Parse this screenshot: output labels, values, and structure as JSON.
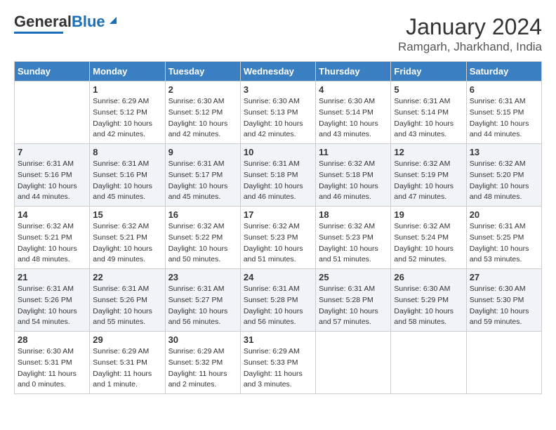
{
  "logo": {
    "text_general": "General",
    "text_blue": "Blue"
  },
  "title": "January 2024",
  "subtitle": "Ramgarh, Jharkhand, India",
  "header_days": [
    "Sunday",
    "Monday",
    "Tuesday",
    "Wednesday",
    "Thursday",
    "Friday",
    "Saturday"
  ],
  "weeks": [
    [
      {
        "num": "",
        "info": ""
      },
      {
        "num": "1",
        "info": "Sunrise: 6:29 AM\nSunset: 5:12 PM\nDaylight: 10 hours\nand 42 minutes."
      },
      {
        "num": "2",
        "info": "Sunrise: 6:30 AM\nSunset: 5:12 PM\nDaylight: 10 hours\nand 42 minutes."
      },
      {
        "num": "3",
        "info": "Sunrise: 6:30 AM\nSunset: 5:13 PM\nDaylight: 10 hours\nand 42 minutes."
      },
      {
        "num": "4",
        "info": "Sunrise: 6:30 AM\nSunset: 5:14 PM\nDaylight: 10 hours\nand 43 minutes."
      },
      {
        "num": "5",
        "info": "Sunrise: 6:31 AM\nSunset: 5:14 PM\nDaylight: 10 hours\nand 43 minutes."
      },
      {
        "num": "6",
        "info": "Sunrise: 6:31 AM\nSunset: 5:15 PM\nDaylight: 10 hours\nand 44 minutes."
      }
    ],
    [
      {
        "num": "7",
        "info": "Sunrise: 6:31 AM\nSunset: 5:16 PM\nDaylight: 10 hours\nand 44 minutes."
      },
      {
        "num": "8",
        "info": "Sunrise: 6:31 AM\nSunset: 5:16 PM\nDaylight: 10 hours\nand 45 minutes."
      },
      {
        "num": "9",
        "info": "Sunrise: 6:31 AM\nSunset: 5:17 PM\nDaylight: 10 hours\nand 45 minutes."
      },
      {
        "num": "10",
        "info": "Sunrise: 6:31 AM\nSunset: 5:18 PM\nDaylight: 10 hours\nand 46 minutes."
      },
      {
        "num": "11",
        "info": "Sunrise: 6:32 AM\nSunset: 5:18 PM\nDaylight: 10 hours\nand 46 minutes."
      },
      {
        "num": "12",
        "info": "Sunrise: 6:32 AM\nSunset: 5:19 PM\nDaylight: 10 hours\nand 47 minutes."
      },
      {
        "num": "13",
        "info": "Sunrise: 6:32 AM\nSunset: 5:20 PM\nDaylight: 10 hours\nand 48 minutes."
      }
    ],
    [
      {
        "num": "14",
        "info": "Sunrise: 6:32 AM\nSunset: 5:21 PM\nDaylight: 10 hours\nand 48 minutes."
      },
      {
        "num": "15",
        "info": "Sunrise: 6:32 AM\nSunset: 5:21 PM\nDaylight: 10 hours\nand 49 minutes."
      },
      {
        "num": "16",
        "info": "Sunrise: 6:32 AM\nSunset: 5:22 PM\nDaylight: 10 hours\nand 50 minutes."
      },
      {
        "num": "17",
        "info": "Sunrise: 6:32 AM\nSunset: 5:23 PM\nDaylight: 10 hours\nand 51 minutes."
      },
      {
        "num": "18",
        "info": "Sunrise: 6:32 AM\nSunset: 5:23 PM\nDaylight: 10 hours\nand 51 minutes."
      },
      {
        "num": "19",
        "info": "Sunrise: 6:32 AM\nSunset: 5:24 PM\nDaylight: 10 hours\nand 52 minutes."
      },
      {
        "num": "20",
        "info": "Sunrise: 6:31 AM\nSunset: 5:25 PM\nDaylight: 10 hours\nand 53 minutes."
      }
    ],
    [
      {
        "num": "21",
        "info": "Sunrise: 6:31 AM\nSunset: 5:26 PM\nDaylight: 10 hours\nand 54 minutes."
      },
      {
        "num": "22",
        "info": "Sunrise: 6:31 AM\nSunset: 5:26 PM\nDaylight: 10 hours\nand 55 minutes."
      },
      {
        "num": "23",
        "info": "Sunrise: 6:31 AM\nSunset: 5:27 PM\nDaylight: 10 hours\nand 56 minutes."
      },
      {
        "num": "24",
        "info": "Sunrise: 6:31 AM\nSunset: 5:28 PM\nDaylight: 10 hours\nand 56 minutes."
      },
      {
        "num": "25",
        "info": "Sunrise: 6:31 AM\nSunset: 5:28 PM\nDaylight: 10 hours\nand 57 minutes."
      },
      {
        "num": "26",
        "info": "Sunrise: 6:30 AM\nSunset: 5:29 PM\nDaylight: 10 hours\nand 58 minutes."
      },
      {
        "num": "27",
        "info": "Sunrise: 6:30 AM\nSunset: 5:30 PM\nDaylight: 10 hours\nand 59 minutes."
      }
    ],
    [
      {
        "num": "28",
        "info": "Sunrise: 6:30 AM\nSunset: 5:31 PM\nDaylight: 11 hours\nand 0 minutes."
      },
      {
        "num": "29",
        "info": "Sunrise: 6:29 AM\nSunset: 5:31 PM\nDaylight: 11 hours\nand 1 minute."
      },
      {
        "num": "30",
        "info": "Sunrise: 6:29 AM\nSunset: 5:32 PM\nDaylight: 11 hours\nand 2 minutes."
      },
      {
        "num": "31",
        "info": "Sunrise: 6:29 AM\nSunset: 5:33 PM\nDaylight: 11 hours\nand 3 minutes."
      },
      {
        "num": "",
        "info": ""
      },
      {
        "num": "",
        "info": ""
      },
      {
        "num": "",
        "info": ""
      }
    ]
  ]
}
